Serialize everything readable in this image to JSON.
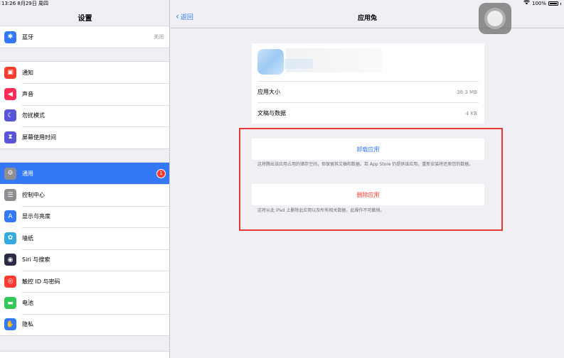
{
  "status": {
    "time_date": "13:26  8月29日 周四",
    "battery": "100%"
  },
  "sidebar": {
    "title": "设置",
    "group0": [
      {
        "label": "蓝牙",
        "value": "关闭",
        "icon": "bluetooth-icon",
        "color": "#3478f6",
        "glyph": "✱"
      }
    ],
    "group1": [
      {
        "label": "通知",
        "icon": "notification-icon",
        "color": "#ff3b30",
        "glyph": "▣"
      },
      {
        "label": "声音",
        "icon": "sound-icon",
        "color": "#ff2d55",
        "glyph": "◀"
      },
      {
        "label": "勿扰模式",
        "icon": "moon-icon",
        "color": "#5856d6",
        "glyph": "☾"
      },
      {
        "label": "屏幕使用时间",
        "icon": "hourglass-icon",
        "color": "#5856d6",
        "glyph": "⧗"
      }
    ],
    "group2": [
      {
        "label": "通用",
        "icon": "gear-icon",
        "color": "#8e8e93",
        "glyph": "⚙",
        "badge": "1",
        "selected": true
      },
      {
        "label": "控制中心",
        "icon": "control-center-icon",
        "color": "#8e8e93",
        "glyph": "☰"
      },
      {
        "label": "显示与亮度",
        "icon": "display-icon",
        "color": "#3478f6",
        "glyph": "A"
      },
      {
        "label": "墙纸",
        "icon": "wallpaper-icon",
        "color": "#34aadc",
        "glyph": "✿"
      },
      {
        "label": "Siri 与搜索",
        "icon": "siri-icon",
        "color": "#2b2b45",
        "glyph": "◉"
      },
      {
        "label": "触控 ID 与密码",
        "icon": "fingerprint-icon",
        "color": "#ff3b30",
        "glyph": "◎"
      },
      {
        "label": "电池",
        "icon": "battery-icon",
        "color": "#34c759",
        "glyph": "▬"
      },
      {
        "label": "隐私",
        "icon": "hand-icon",
        "color": "#3478f6",
        "glyph": "✋"
      }
    ]
  },
  "detail": {
    "back_label": "返回",
    "title": "应用兔",
    "app_size_label": "应用大小",
    "app_size_value": "38.3 MB",
    "docs_label": "文稿与数据",
    "docs_value": "4 KB",
    "offload_label": "卸载应用",
    "offload_note": "这将腾出该应用占用的储存空间，但保留其文稿和数据。若 App Store 仍提供该应用，重新安装将还原您的数据。",
    "delete_label": "删除应用",
    "delete_note": "这将从此 iPad 上删除此应用以及所有相关数据。此操作不可撤销。"
  }
}
